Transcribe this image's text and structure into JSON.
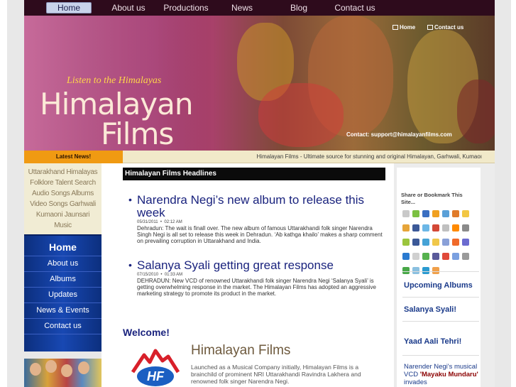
{
  "nav": {
    "items": [
      {
        "label": "Home",
        "active": true
      },
      {
        "label": "About us",
        "active": false
      },
      {
        "label": "Productions",
        "active": false
      },
      {
        "label": "News",
        "active": false
      },
      {
        "label": "Blog",
        "active": false
      },
      {
        "label": "Contact us",
        "active": false
      }
    ]
  },
  "banner": {
    "tagline": "Listen to the Himalayas",
    "brand_line1": "Himalayan",
    "brand_line2": "Films",
    "quick_home": "Home",
    "quick_contact": "Contact us",
    "contact": "Contact: support@himalayanfilms.com"
  },
  "newsbar": {
    "label": "Latest News!",
    "ticker": "Himalayan Films - Ultimate source for stunning and original Himalayan, Garhwali, Kumaoı"
  },
  "left_links": [
    "Uttarakhand Himalayas",
    "Folklore Talent Search",
    "Audio Songs Albums",
    "Video Songs Garhwali",
    "Kumaoni Jaunsari",
    "Music"
  ],
  "left_menu": [
    "Home",
    "About us",
    "Albums",
    "Updates",
    "News & Events",
    "Contact us"
  ],
  "main": {
    "headlines_title": "Himalayan Films Headlines",
    "articles": [
      {
        "title": "Narendra Negi’s new album to release this week",
        "date": "05/31/2011",
        "time": "02:12 AM",
        "body": "Dehradun: The wait is finall over. The new album of famous Uttarakhandi folk singer Narendra Singh Negi is all set to release this week in Dehradun. ‘Ab kathga khailo’ makes a sharp comment on prevailing corruption in Uttarakhand and India."
      },
      {
        "title": "Salanya Syali getting great response",
        "date": "07/15/2010",
        "time": "01:33 AM",
        "body": "DEHRADUN: New VCD of renowned Uttarakhandi folk singer Narendra Negi ‘Salanya Syali’ is getting overwhelming response in the market. The Himalayan Films has adopted an aggressive marketing strategy to promote its product in the market."
      }
    ],
    "welcome": "Welcome!",
    "logo_text": "HF",
    "hf_title": "Himalayan Films",
    "hf_text": "Launched as a Musical Company initially, Himalayan Films is a brainchild of prominent NRI Uttarakhandi Ravindra Lakhera and renowned folk singer Narendra Negi."
  },
  "right": {
    "share_title": "Share or Bookmark This Site...",
    "share_icon_colors": [
      "#c9c9c9",
      "#7cc142",
      "#3b6fc2",
      "#f0a020",
      "#5aa0d8",
      "#e07b2a",
      "#f2c744",
      "#e6a53a",
      "#3b5998",
      "#6cb7e6",
      "#d34836",
      "#c0c0c0",
      "#ff8a00",
      "#8a8a8a",
      "#9bc53d",
      "#3b5998",
      "#46a3d6",
      "#f0c74a",
      "#8aa0d8",
      "#f06a2a",
      "#6b6bd0",
      "#2a7ad0",
      "#d0d0d0",
      "#56b24f",
      "#5a5a9a",
      "#e04a3a",
      "#7aa0e0",
      "#9a9a9a",
      "#48a848",
      "#8ac0e0",
      "#2a9ad0",
      "#f0a04a"
    ],
    "links": [
      "Upcoming Albums",
      "Salanya Syali!",
      "Yaad Aali Tehri!"
    ],
    "para_pre": "Narender Negi's musical VCD ",
    "para_bold": "'Mayaku Mundaru'",
    "para_post": " invades"
  }
}
